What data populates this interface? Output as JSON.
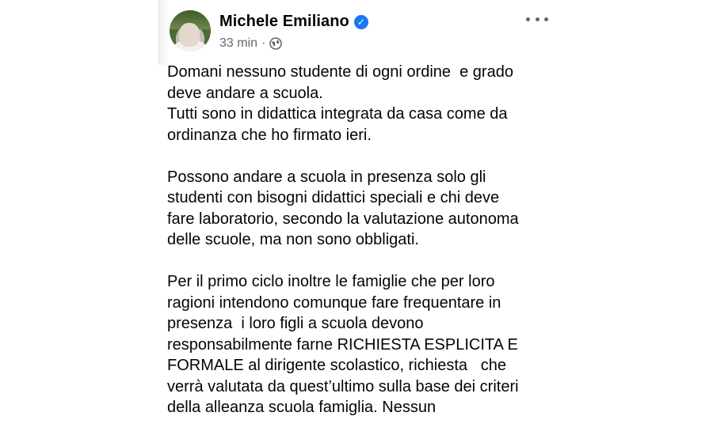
{
  "post": {
    "author": "Michele Emiliano",
    "time": "33 min",
    "separator": "·",
    "icons": {
      "verified": "verified-badge-icon",
      "audience": "globe-icon",
      "menu": "more-options-icon"
    },
    "colors": {
      "verified": "#1877f2",
      "meta": "#65676b",
      "text": "#050505"
    },
    "text": "Domani nessuno studente di ogni ordine  e grado\ndeve andare a scuola.\nTutti sono in didattica integrata da casa come da\nordinanza che ho firmato ieri.\n\nPossono andare a scuola in presenza solo gli\nstudenti con bisogni didattici speciali e chi deve\nfare laboratorio, secondo la valutazione autonoma\ndelle scuole, ma non sono obbligati.\n\nPer il primo ciclo inoltre le famiglie che per loro\nragioni intendono comunque fare frequentare in\npresenza  i loro figli a scuola devono\nresponsabilmente farne RICHIESTA ESPLICITA E\nFORMALE al dirigente scolastico, richiesta   che\nverrà valutata da quest’ultimo sulla base dei criteri\ndella alleanza scuola famiglia. Nessun"
  }
}
